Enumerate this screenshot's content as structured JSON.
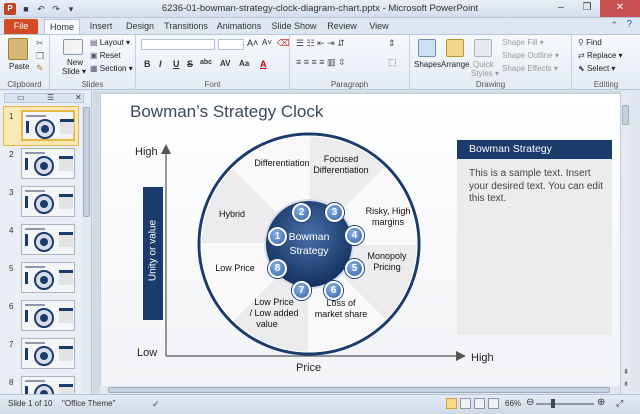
{
  "window": {
    "app_icon": "P",
    "title": "6236-01-bowman-strategy-clock-diagram-chart.pptx - Microsoft PowerPoint",
    "controls": [
      "–",
      "❐",
      "✕"
    ],
    "quick_access": [
      "save-icon",
      "undo-icon",
      "redo-icon",
      "customize-icon"
    ]
  },
  "tabs": [
    "File",
    "Home",
    "Insert",
    "Design",
    "Transitions",
    "Animations",
    "Slide Show",
    "Review",
    "View"
  ],
  "ribbon": {
    "clipboard": {
      "label": "Clipboard",
      "paste": "Paste"
    },
    "slides": {
      "label": "Slides",
      "new_slide": "New",
      "new_slide_2": "Slide ▾",
      "layout": "Layout ▾",
      "reset": "Reset",
      "section": "Section ▾"
    },
    "font": {
      "label": "Font",
      "bold": "B",
      "italic": "I",
      "underline": "U",
      "strike": "S",
      "shadow": "abc",
      "spacing": "AV",
      "case": "Aa",
      "color": "A"
    },
    "paragraph": {
      "label": "Paragraph"
    },
    "drawing": {
      "label": "Drawing",
      "shapes": "Shapes",
      "arrange": "Arrange",
      "quick_styles": "Quick",
      "quick_styles_2": "Styles ▾",
      "shape_fill": "Shape Fill ▾",
      "shape_outline": "Shape Outline ▾",
      "shape_effects": "Shape Effects ▾"
    },
    "editing": {
      "label": "Editing",
      "find": "Find",
      "replace": "Replace ▾",
      "select": "Select ▾"
    }
  },
  "slide_panel": {
    "slide_numbers": [
      "1",
      "2",
      "3",
      "4",
      "5",
      "6",
      "7",
      "8"
    ],
    "selected_index": 1
  },
  "slide": {
    "title": "Bowman’s Strategy Clock",
    "y_axis_label": "Unity or value",
    "y_high": "High",
    "y_low": "Low",
    "x_high": "High",
    "x_label": "Price",
    "center": [
      "Bowman",
      "Strategy"
    ],
    "segments": {
      "differentiation": "Differentiation",
      "focused_1": "Focused",
      "focused_2": "Differentiation",
      "hybrid": "Hybrid",
      "risky_1": "Risky, High",
      "risky_2": "margins",
      "low_price": "Low Price",
      "monopoly_1": "Monopoly",
      "monopoly_2": "Pricing",
      "lowadd_1": "Low Price",
      "lowadd_2": "/ Low added",
      "lowadd_3": "value",
      "loss_1": "Loss of",
      "loss_2": "market share"
    },
    "numbers": [
      "1",
      "2",
      "3",
      "4",
      "5",
      "6",
      "7",
      "8"
    ],
    "info_box": {
      "title": "Bowman Strategy",
      "body": "This is a sample text. Insert your desired text. You can edit this text."
    }
  },
  "status": {
    "slide_of": "Slide 1 of 10",
    "theme": "\"Office Theme\"",
    "zoom": "66%"
  }
}
